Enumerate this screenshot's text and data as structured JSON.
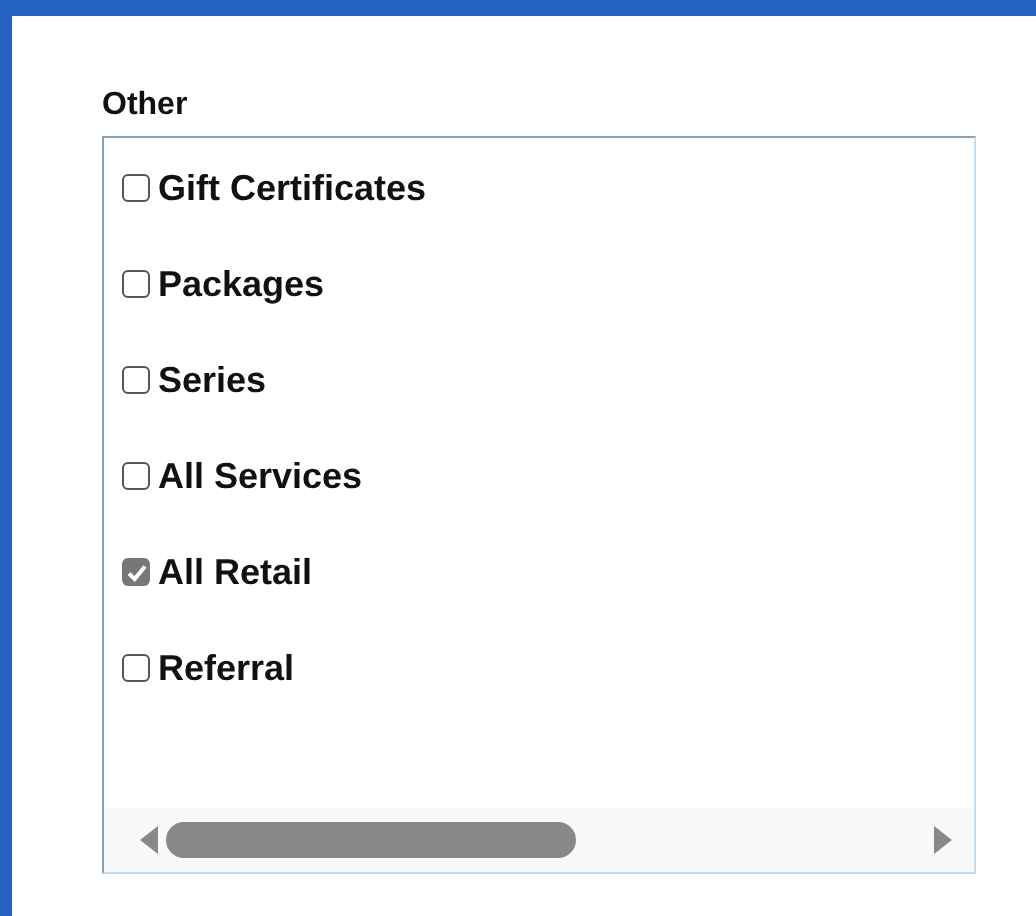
{
  "group": {
    "label": "Other",
    "items": [
      {
        "label": "Gift Certificates",
        "checked": false
      },
      {
        "label": "Packages",
        "checked": false
      },
      {
        "label": "Series",
        "checked": false
      },
      {
        "label": "All Services",
        "checked": false
      },
      {
        "label": "All Retail",
        "checked": true
      },
      {
        "label": "Referral",
        "checked": false
      }
    ]
  }
}
